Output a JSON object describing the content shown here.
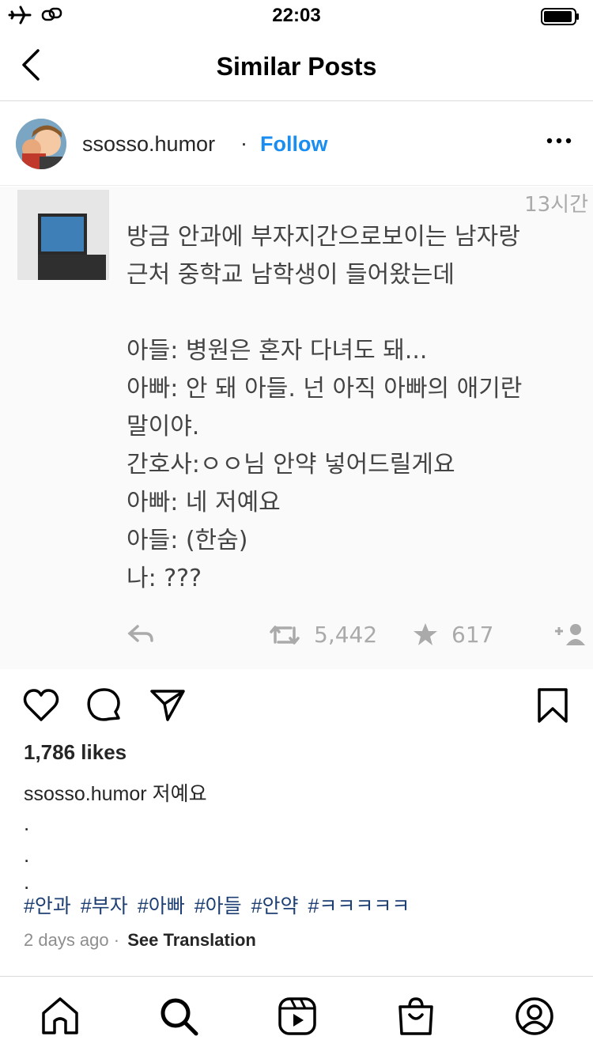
{
  "status_bar": {
    "time": "22:03"
  },
  "nav": {
    "title": "Similar Posts"
  },
  "post": {
    "username": "ssosso.humor",
    "separator": "·",
    "follow_label": "Follow",
    "image": {
      "tweet_time": "13시간",
      "tweet_text": "방금 안과에 부자지간으로보이는 남자랑\n근처 중학교 남학생이 들어왔는데\n\n아들: 병원은 혼자 다녀도 돼...\n아빠: 안 돼 아들. 넌 아직 아빠의 애기란\n말이야.\n간호사:ㅇㅇ님 안약 넣어드릴게요\n아빠: 네 저예요\n아들: (한숨)\n나: ???",
      "retweets": "5,442",
      "favorites": "617"
    },
    "likes": "1,786 likes",
    "caption_user": "ssosso.humor",
    "caption_text": "저예요",
    "caption_dots": [
      ".",
      ".",
      "."
    ],
    "hashtags": [
      "#안과",
      "#부자",
      "#아빠",
      "#아들",
      "#안약",
      "#ㅋㅋㅋㅋㅋ"
    ],
    "time_ago": "2 days ago",
    "meta_separator": "·",
    "see_translation": "See Translation"
  },
  "colors": {
    "link_blue": "#1a8ef0",
    "hashtag_blue": "#1d3f73",
    "muted_gray": "#8e8e8e"
  }
}
